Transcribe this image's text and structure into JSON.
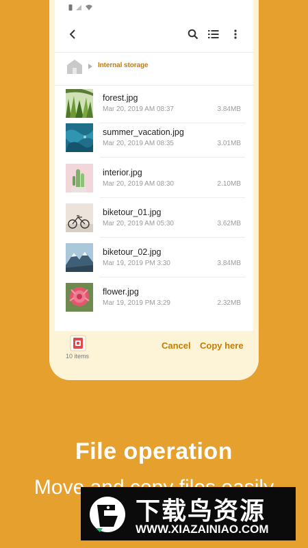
{
  "breadcrumb": {
    "label": "Internal storage"
  },
  "files": [
    {
      "name": "forest.jpg",
      "date": "Mar 20, 2019 AM 08:37",
      "size": "3.84MB"
    },
    {
      "name": "summer_vacation.jpg",
      "date": "Mar 20, 2019 AM 08:35",
      "size": "3.01MB"
    },
    {
      "name": "interior.jpg",
      "date": "Mar 20, 2019 AM 08:30",
      "size": "2.10MB"
    },
    {
      "name": "biketour_01.jpg",
      "date": "Mar 20, 2019 AM 05:30",
      "size": "3.62MB"
    },
    {
      "name": "biketour_02.jpg",
      "date": "Mar 19, 2019 PM 3:30",
      "size": "3.84MB"
    },
    {
      "name": "flower.jpg",
      "date": "Mar 19, 2019 PM 3:29",
      "size": "2.32MB"
    }
  ],
  "bottom_bar": {
    "items_count": "10 items",
    "cancel_label": "Cancel",
    "copy_label": "Copy here"
  },
  "promo": {
    "headline": "File operation",
    "subline": "Move and copy files easily"
  },
  "watermark": {
    "title": "下载鸟资源",
    "url": "WWW.XIAZAINIAO.COM"
  },
  "colors": {
    "background": "#E6A02E",
    "accent": "#C67B00",
    "bottom_bar": "#FDF3D7"
  },
  "icons": [
    "back-arrow-icon",
    "search-icon",
    "list-view-icon",
    "more-vert-icon",
    "home-icon",
    "chevron-right-icon",
    "clipboard-icon"
  ]
}
